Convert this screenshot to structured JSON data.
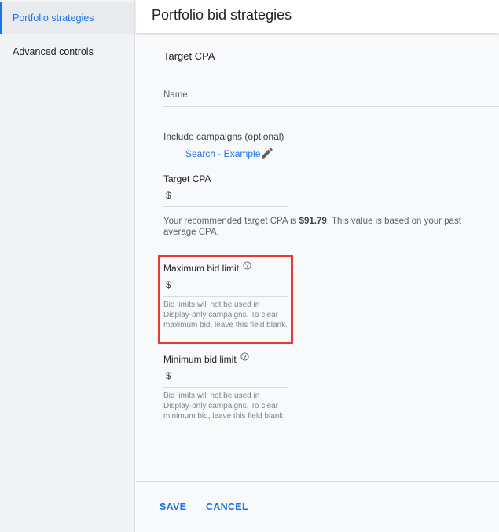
{
  "sidebar": {
    "items": [
      {
        "label": "Portfolio strategies",
        "active": true
      },
      {
        "label": "Advanced controls",
        "active": false
      }
    ]
  },
  "header": {
    "title": "Portfolio bid strategies"
  },
  "form": {
    "section_title": "Target CPA",
    "name_placeholder": "Name",
    "include_label": "Include campaigns (optional)",
    "campaign_link": "Search - Example",
    "target_cpa": {
      "label": "Target CPA",
      "currency": "$",
      "value": ""
    },
    "recommendation": {
      "prefix": "Your recommended target CPA is ",
      "amount": "$91.79",
      "suffix": ". This value is based on your past average CPA."
    },
    "max_bid": {
      "label": "Maximum bid limit",
      "currency": "$",
      "help": "Bid limits will not be used in Display-only campaigns. To clear maximum bid, leave this field blank."
    },
    "min_bid": {
      "label": "Minimum bid limit",
      "currency": "$",
      "help": "Bid limits will not be used in Display-only campaigns. To clear minimum bid, leave this field blank."
    }
  },
  "footer": {
    "save_label": "SAVE",
    "cancel_label": "CANCEL"
  },
  "colors": {
    "accent": "#1a73e8",
    "highlight": "#e53935"
  },
  "icons": {
    "edit": "pencil-icon",
    "help": "help-circle-icon"
  }
}
